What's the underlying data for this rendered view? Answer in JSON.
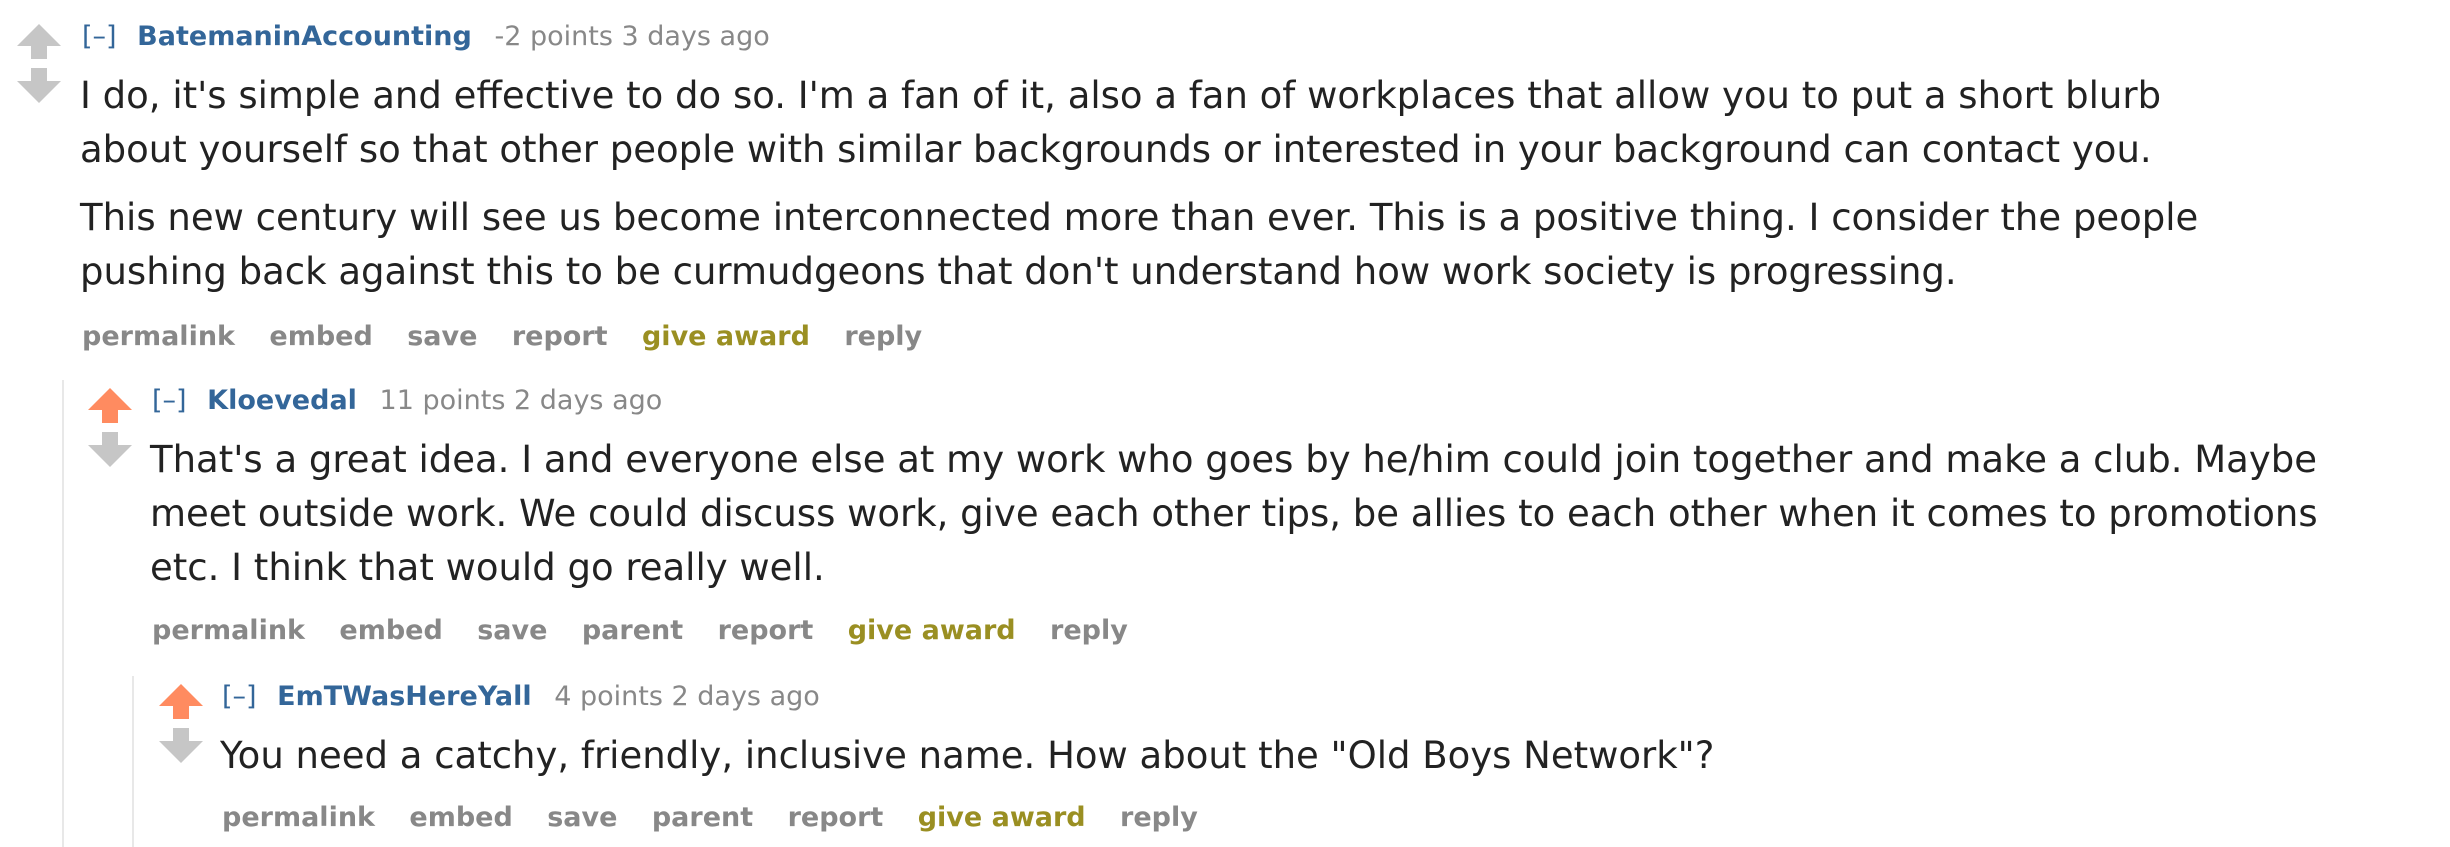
{
  "comments": [
    {
      "collapse": "[–]",
      "author": "BatemaninAccounting",
      "score": "-2 points",
      "time": "3 days ago",
      "paragraphs": [
        "I do, it's simple and effective to do so. I'm a fan of it, also a fan of workplaces that allow you to put a short blurb",
        "about yourself so that other people with similar backgrounds or interested in your background can contact you.",
        "This new century will see us become interconnected more than ever. This is a positive thing. I consider the people",
        "pushing back against this to be curmudgeons that don't understand how work society is progressing."
      ],
      "buttons": {
        "permalink": "permalink",
        "embed": "embed",
        "save": "save",
        "report": "report",
        "give_award": "give award",
        "reply": "reply"
      },
      "upvoted": false
    },
    {
      "collapse": "[–]",
      "author": "Kloevedal",
      "score": "11 points",
      "time": "2 days ago",
      "paragraphs": [
        "That's a great idea. I and everyone else at my work who goes by he/him could join together and make a club. Maybe",
        "meet outside work. We could discuss work, give each other tips, be allies to each other when it comes to promotions",
        "etc. I think that would go really well."
      ],
      "buttons": {
        "permalink": "permalink",
        "embed": "embed",
        "save": "save",
        "parent": "parent",
        "report": "report",
        "give_award": "give award",
        "reply": "reply"
      },
      "upvoted": true
    },
    {
      "collapse": "[–]",
      "author": "EmTWasHereYall",
      "score": "4 points",
      "time": "2 days ago",
      "paragraphs": [
        "You need a catchy, friendly, inclusive name. How about the \"Old Boys Network\"?"
      ],
      "buttons": {
        "permalink": "permalink",
        "embed": "embed",
        "save": "save",
        "parent": "parent",
        "report": "report",
        "give_award": "give award",
        "reply": "reply"
      },
      "upvoted": true
    }
  ],
  "colors": {
    "author": "#336699",
    "upvote": "#ff8b60",
    "neutral_arrow": "#c6c6c6",
    "award": "#9a8f22",
    "meta": "#888888"
  }
}
